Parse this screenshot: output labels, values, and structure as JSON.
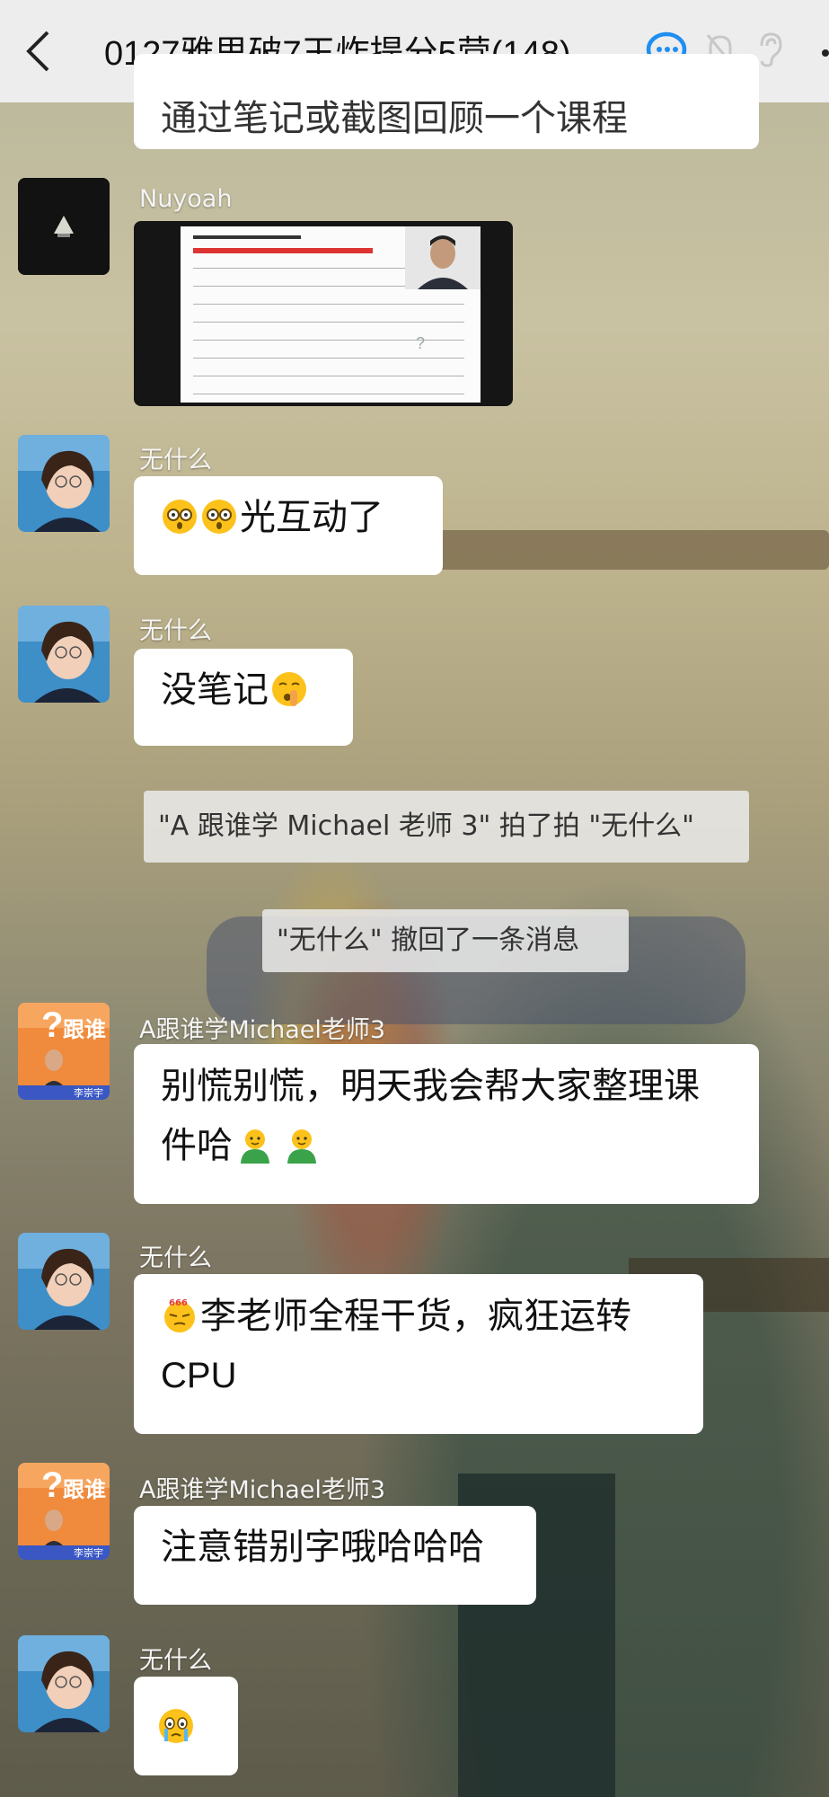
{
  "header": {
    "title": "0127雅思破7王炸提分5营(148)"
  },
  "top_partial_message": "通过笔记或截图回顾一个课程",
  "messages": [
    {
      "sender": "Nuyoah",
      "type": "image"
    },
    {
      "sender": "无什么",
      "text": "光互动了",
      "emoji": [
        "face-icon",
        "face-icon"
      ]
    },
    {
      "sender": "无什么",
      "text": "没笔记",
      "emoji_after": "shush-face-icon"
    },
    {
      "system": "\"A 跟谁学 Michael 老师 3\" 拍了拍 \"无什么\""
    },
    {
      "system": "\"无什么\" 撤回了一条消息"
    },
    {
      "sender": "A跟谁学Michael老师3",
      "text_line1": "别慌别慌，明天我会帮大家整理课",
      "text_line2": "件哈"
    },
    {
      "sender": "无什么",
      "text_line1": "李老师全程干货，疯狂运转",
      "text_line2": "CPU",
      "emoji_badge": "666"
    },
    {
      "sender": "A跟谁学Michael老师3",
      "text": "注意错别字哦哈哈哈"
    },
    {
      "sender": "无什么",
      "emoji_only": "crying-face-icon"
    }
  ],
  "colors": {
    "topbar": "#ededed",
    "bubble": "#ffffff",
    "qq_blue": "#1f8ef1"
  }
}
